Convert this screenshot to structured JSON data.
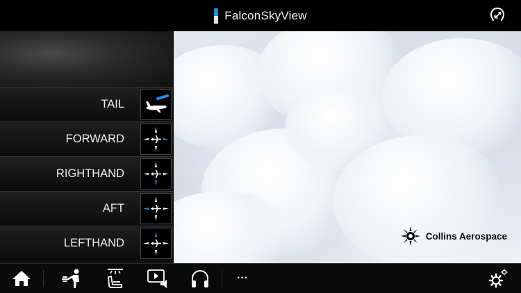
{
  "app": {
    "title": "FalconSkyView"
  },
  "views": [
    {
      "label": "TAIL",
      "icon": "tail-camera-icon"
    },
    {
      "label": "FORWARD",
      "icon": "forward-view-icon"
    },
    {
      "label": "RIGHTHAND",
      "icon": "righthand-view-icon"
    },
    {
      "label": "AFT",
      "icon": "aft-view-icon"
    },
    {
      "label": "LEFTHAND",
      "icon": "lefthand-view-icon"
    }
  ],
  "brand": {
    "name": "Collins Aerospace"
  },
  "bottom_nav": {
    "items": [
      "home-icon",
      "attendant-call-icon",
      "seat-light-icon",
      "media-icon",
      "headphones-icon"
    ],
    "more_label": "···"
  },
  "colors": {
    "accent": "#1e8fe0",
    "background": "#000000"
  }
}
